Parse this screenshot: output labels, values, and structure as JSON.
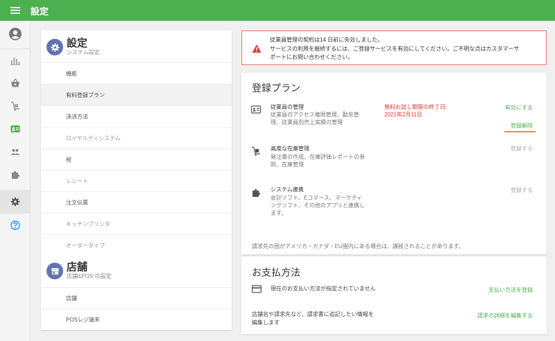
{
  "app": {
    "title": "設定"
  },
  "colors": {
    "brand": "#4caf50",
    "danger": "#e53935",
    "accent_underline": "#ef8a3b",
    "badge_bg": "#6274b0"
  },
  "rail": {
    "items": [
      {
        "name": "analytics-icon"
      },
      {
        "name": "basket-icon"
      },
      {
        "name": "inventory-icon"
      },
      {
        "name": "employee-card-icon"
      },
      {
        "name": "customers-icon"
      },
      {
        "name": "puzzle-icon"
      },
      {
        "name": "settings-icon"
      },
      {
        "name": "help-icon"
      }
    ]
  },
  "settings_section": {
    "title": "設定",
    "subtitle": "システム設定"
  },
  "settings_nav": [
    {
      "label": "機能"
    },
    {
      "label": "有料登録プラン"
    },
    {
      "label": "決済方法"
    },
    {
      "label": "ロイヤルティシステム"
    },
    {
      "label": "税"
    },
    {
      "label": "レシート"
    },
    {
      "label": "注文伝票"
    },
    {
      "label": "キッチンプリンタ"
    },
    {
      "label": "オーダータイプ"
    }
  ],
  "store_section": {
    "title": "店舗",
    "subtitle": "店舗&POS の設定"
  },
  "store_nav": [
    {
      "label": "店舗"
    },
    {
      "label": "POSレジ端末"
    }
  ],
  "alert": {
    "line1": "従業員管理の契約は14 日前に失効しました。",
    "line2": "サービスの利用を継続するには、ご登録サービスを有効にしてください。ご不明な点はカスタマーサ",
    "line3": "ポートにお問い合わせください。"
  },
  "plan": {
    "title": "登録プラン",
    "items": [
      {
        "title": "従業員の管理",
        "desc1": "従業員のアクセス権限管理、勤怠管",
        "desc2": "理、従業員別売上実績の管理",
        "trial1": "無料お試し期間の終了日:",
        "trial2": "2021年2月11日",
        "action1": "有効にする",
        "action2": "登録解除"
      },
      {
        "title": "高度な在庫管理",
        "desc1": "発注書の作成、在庫評価レポートの参",
        "desc2": "照、在庫管理",
        "action1": "登録する"
      },
      {
        "title": "システム連携",
        "desc1": "会計ソフト、Eコマース、マーケティ",
        "desc2": "ングソフト、その他のアプリと連携し",
        "desc3": "ます。",
        "action1": "登録する"
      }
    ],
    "note": "請求先の国がアメリカ・カナダ・EU圏内にある場合は、課税されることがあります。"
  },
  "payment": {
    "title": "お支払方法",
    "status": "現在のお支払い方法が指定されていません",
    "register": "支払い方法を登録",
    "info1": "店舗名や請求先など、請求書に追記したい情報を",
    "info2": "編集します",
    "edit": "請求の詳細を編集する"
  }
}
